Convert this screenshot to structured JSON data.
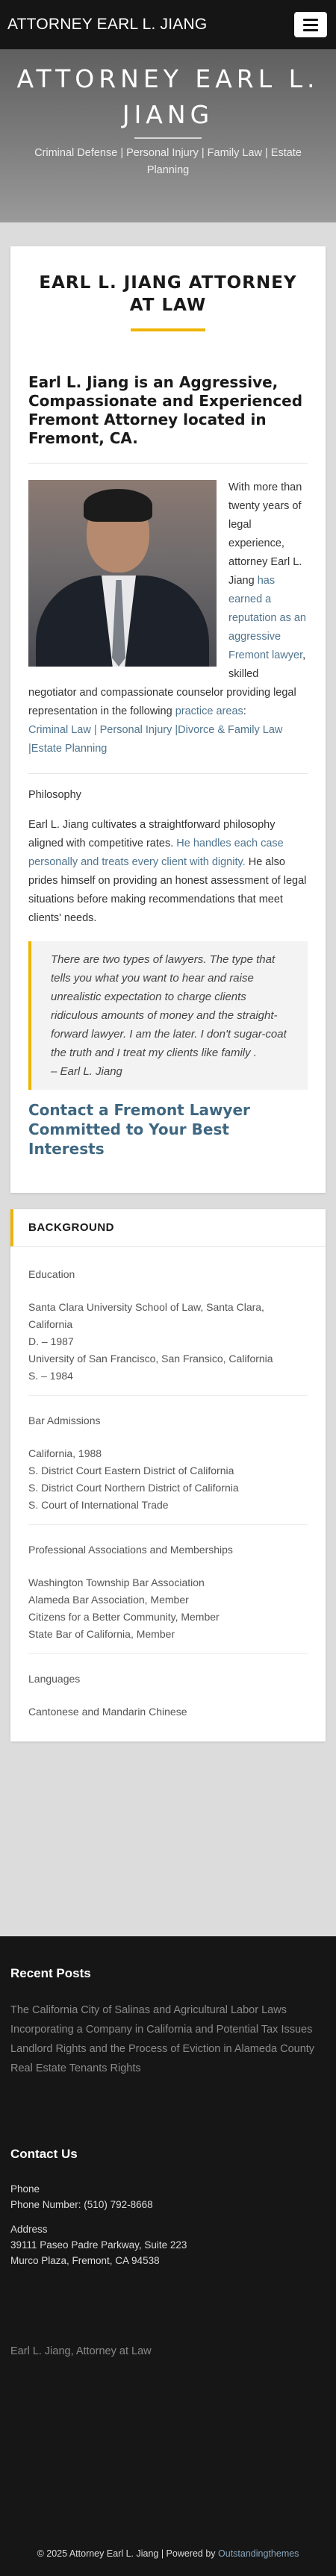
{
  "nav": {
    "brand": "ATTORNEY EARL L. JIANG",
    "menu_label": "Toggle navigation"
  },
  "hero": {
    "title": "ATTORNEY EARL L. JIANG",
    "subtitle": "Criminal Defense | Personal Injury | Family Law | Estate Planning"
  },
  "main": {
    "title": "EARL L. JIANG ATTORNEY AT LAW",
    "intro_heading": "Earl L. Jiang is an Aggressive, Compassionate and Experienced Fremont Attorney located in Fremont, CA.",
    "photo_alt": "Earl L. Jiang portrait",
    "bio_part1": "With more than twenty years of legal experience, attorney Earl L. Jiang ",
    "bio_link1": "has earned a reputation as an aggressive Fremont lawyer",
    "bio_part2": ", skilled negotiator and compassionate counselor providing legal representation in the following ",
    "bio_link2": "practice areas",
    "bio_part3": ":",
    "practice_areas": [
      {
        "label": "Criminal Law"
      },
      {
        "label": "Personal Injury"
      },
      {
        "label": "Divorce & Family Law"
      },
      {
        "label": "Estate Planning"
      }
    ],
    "philosophy_label": "Philosophy",
    "philosophy_part1": "Earl L. Jiang cultivates a straightforward philosophy aligned with competitive rates. ",
    "philosophy_link": "He handles each case personally and treats every client with dignity.",
    "philosophy_part2": " He also prides himself on providing an honest assessment of legal situations before making recommendations that meet clients' needs.",
    "quote": "There are two types of lawyers. The type that tells you what you want to hear and raise unrealistic expectation to charge clients ridiculous amounts of money and the straight-forward lawyer. I am the later. I don't sugar-coat the truth and I treat my clients like family .",
    "quote_author": "– Earl L. Jiang",
    "cta": "Contact a Fremont Lawyer Committed to Your Best Interests"
  },
  "background": {
    "heading": "BACKGROUND",
    "education_label": "Education",
    "education": [
      "Santa Clara University School of Law, Santa Clara, California",
      "D. – 1987",
      "University of San Francisco, San Fransico, California",
      "S. – 1984"
    ],
    "bar_label": "Bar Admissions",
    "bar": [
      "California, 1988",
      "S. District Court Eastern District of California",
      "S. District Court Northern District of California",
      "S. Court of International Trade"
    ],
    "memberships_label": "Professional Associations and Memberships",
    "memberships": [
      "Washington Township Bar Association",
      "Alameda Bar Association, Member",
      "Citizens for a Better Community, Member",
      "State Bar of California, Member"
    ],
    "languages_label": "Languages",
    "languages": "Cantonese and Mandarin Chinese"
  },
  "footer": {
    "recent_title": "Recent Posts",
    "recent_posts": [
      "The California City of Salinas and Agricultural Labor Laws",
      "Incorporating a Company in California and Potential Tax Issues",
      "Landlord Rights and the Process of Eviction in Alameda County",
      "Real Estate Tenants Rights"
    ],
    "contact_title": "Contact Us",
    "phone_label": "Phone",
    "phone": "Phone Number: (510) 792-8668",
    "address_label": "Address",
    "address_line1": "39111 Paseo Padre Parkway, Suite 223",
    "address_line2": "Murco Plaza, Fremont, CA 94538",
    "site_name": "Earl L. Jiang, Attorney at Law",
    "copyright": "© 2025 Attorney Earl L. Jiang | Powered by ",
    "powered_by": "Outstandingthemes"
  },
  "colors": {
    "accent": "#f0b400",
    "link": "#50758f",
    "footer_bg": "#161616"
  }
}
